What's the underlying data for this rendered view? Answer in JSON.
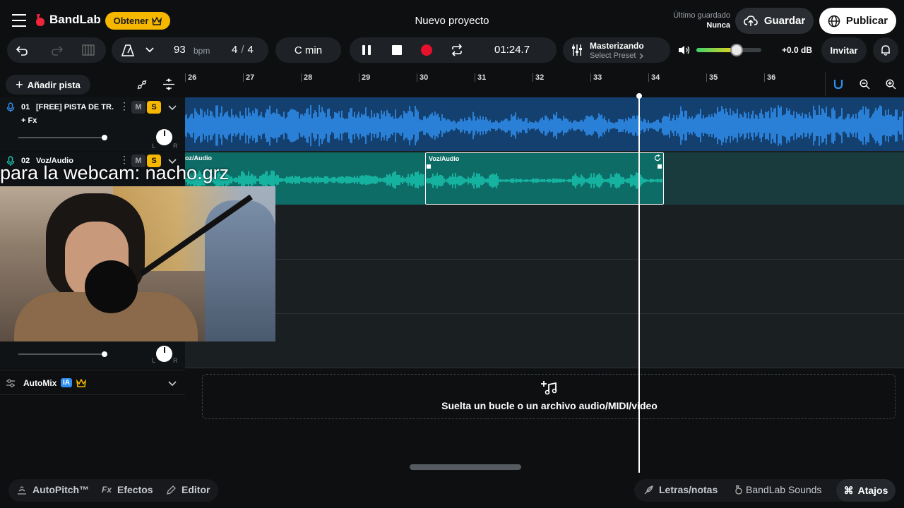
{
  "header": {
    "brand": "BandLab",
    "get_label": "Obtener",
    "project_title": "Nuevo proyecto",
    "last_saved_label": "Último guardado",
    "last_saved_value": "Nunca",
    "save_label": "Guardar",
    "publish_label": "Publicar"
  },
  "toolbar": {
    "bpm_value": "93",
    "bpm_unit": "bpm",
    "time_sig_num": "4",
    "time_sig_sep": "/",
    "time_sig_den": "4",
    "key": "C min",
    "time": "01:24.7",
    "mastering_title": "Masterizando",
    "mastering_preset": "Select Preset",
    "volume_db": "+0.0 dB",
    "volume_level": 0.62,
    "invite_label": "Invitar"
  },
  "left": {
    "add_track_label": "Añadir pista",
    "tracks": [
      {
        "number": "01",
        "name": "[FREE] PISTA DE TR...",
        "fx": "+ Fx",
        "mute": "M",
        "solo": "S"
      },
      {
        "number": "02",
        "name": "Voz/Audio",
        "mute": "M",
        "solo": "S"
      }
    ],
    "automix_label": "AutoMix",
    "automix_badge": "IA"
  },
  "ruler": {
    "bars": [
      "26",
      "27",
      "28",
      "29",
      "30",
      "31",
      "32",
      "33",
      "34",
      "35",
      "36"
    ]
  },
  "clips": {
    "voice_clip_a": "oz/Audio",
    "voice_clip_b": "Voz/Audio"
  },
  "overlay": {
    "webcam_text": "para la webcam: nacho.grz"
  },
  "dropzone": {
    "label": "Suelta un bucle o un archivo audio/MIDI/video"
  },
  "bottom": {
    "autopitch": "AutoPitch™",
    "effects": "Efectos",
    "editor": "Editor",
    "lyrics": "Letras/notas",
    "sounds": "BandLab Sounds",
    "shortcuts": "Atajos"
  },
  "colors": {
    "accent_yellow": "#f5b700",
    "track1_blue": "#2f8ff0",
    "track2_teal": "#19c9b3",
    "record_red": "#e8112d"
  }
}
